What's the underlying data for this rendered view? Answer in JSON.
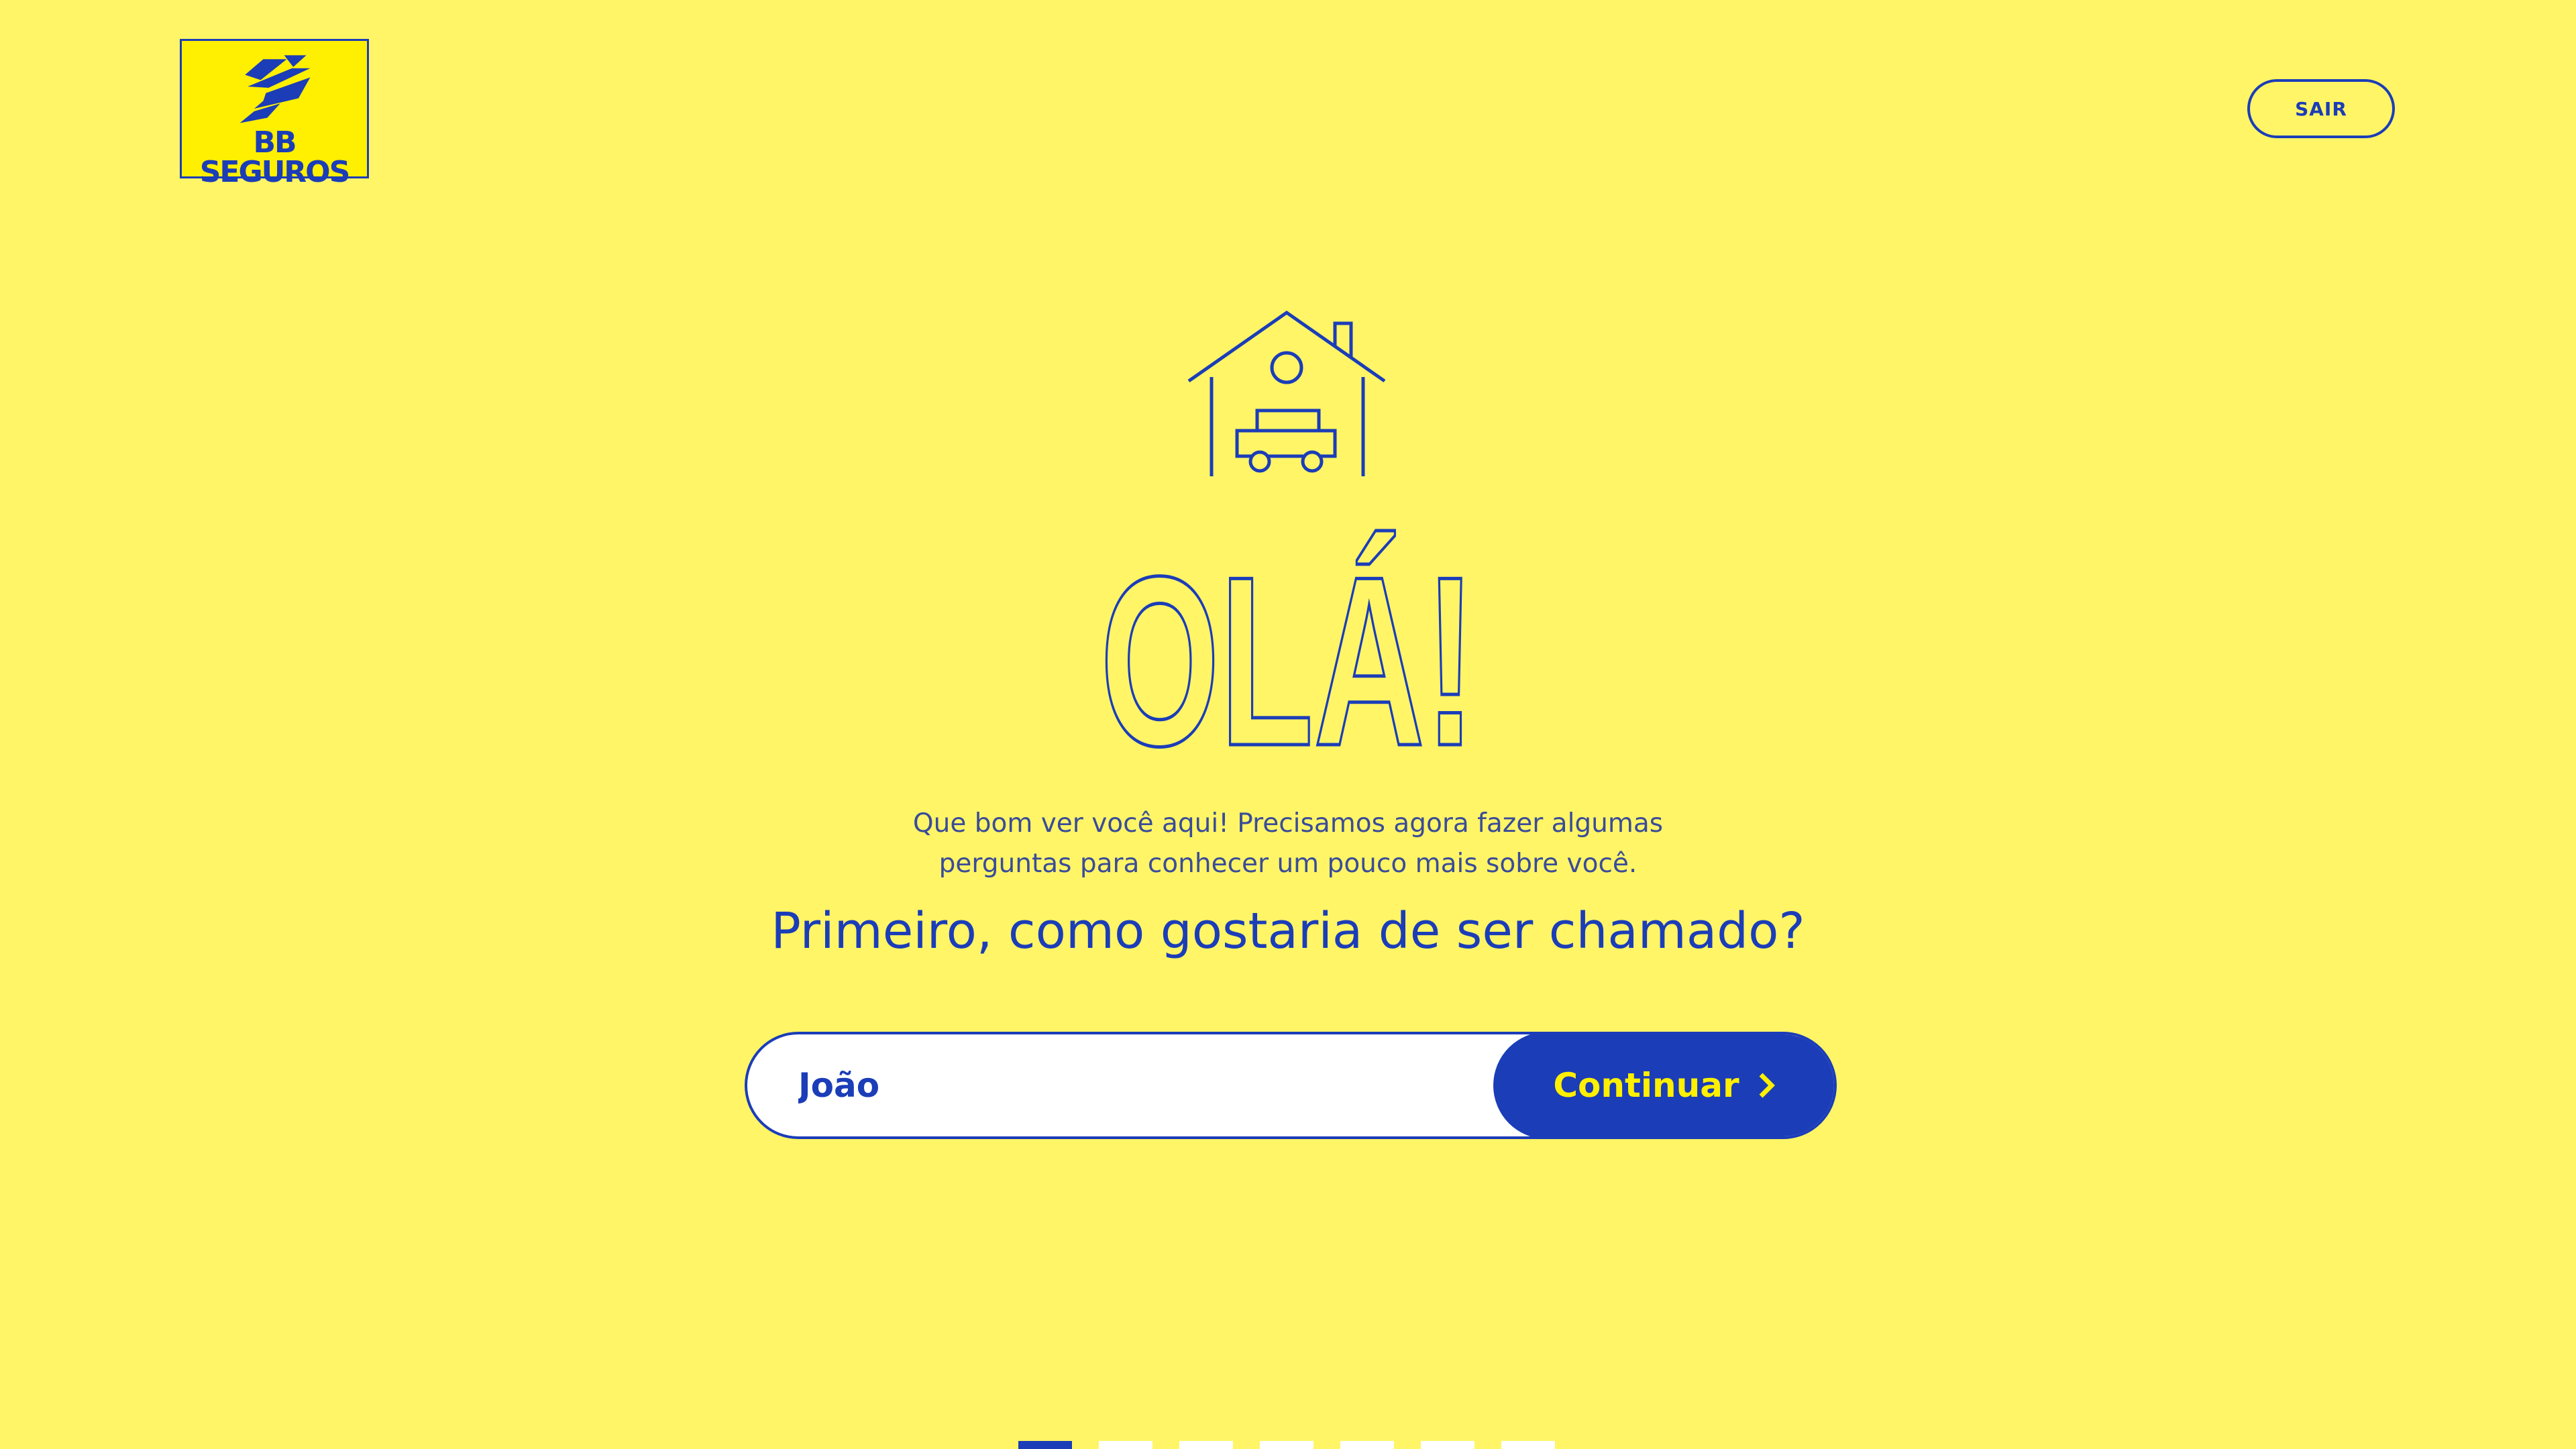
{
  "brand": {
    "logo_text": "BB SEGUROS",
    "logo_icon": "banco-do-brasil-symbol-icon",
    "colors": {
      "background": "#FFF566",
      "primary": "#1B3DB8",
      "accent": "#FFEF00"
    }
  },
  "header": {
    "exit_label": "SAIR"
  },
  "hero": {
    "icon": "house-with-car-icon",
    "greeting": "OLÁ!",
    "intro_line1": "Que bom ver você aqui! Precisamos agora fazer algumas",
    "intro_line2": "perguntas para conhecer um pouco mais sobre você.",
    "question": "Primeiro, como gostaria de ser chamado?"
  },
  "form": {
    "name_value": "João",
    "continue_label": "Continuar",
    "continue_icon": "chevron-right-icon"
  },
  "progress": {
    "total_steps": 7,
    "current_step": 1
  }
}
